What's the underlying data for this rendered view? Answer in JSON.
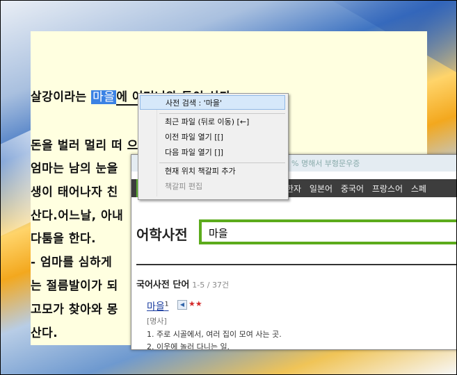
{
  "reader": {
    "lines": [
      {
        "pre": "살강이라는 ",
        "hl": "마을",
        "post": "에 어머니와 둘이 산다."
      },
      {
        "text": "돈을 벌러 멀리 떠                                  으며 엄마랑 둘이산다."
      },
      {
        "text": "엄마는 남의 눈을 "
      },
      {
        "text": "생이 태어나자 친"
      },
      {
        "text": "산다.어느날, 아내"
      },
      {
        "text": "다툼을 한다."
      },
      {
        "text": "- 엄마를 심하게 "
      },
      {
        "text": "는 절름발이가 되"
      },
      {
        "text": "고모가 찾아와 몽"
      },
      {
        "text": "산다."
      }
    ]
  },
  "context_menu": {
    "items": [
      {
        "label": "사전 검색 : '마을'",
        "state": "selected"
      },
      {
        "label": "최근 파일 (뒤로 이동) [←]",
        "state": "normal"
      },
      {
        "label": "이전 파일 열기 [[]",
        "state": "normal"
      },
      {
        "label": "다음 파일 열기 []]",
        "state": "normal"
      },
      {
        "label": "현재 위치 책갈피 추가",
        "state": "normal"
      },
      {
        "label": "책갈피 편집",
        "state": "disabled"
      }
    ]
  },
  "dictionary": {
    "top_blur": "% 명해서 부형문우증",
    "nav": [
      "한자",
      "일본어",
      "중국어",
      "프랑스어",
      "스페"
    ],
    "title": "어학사전",
    "search_value": "마을",
    "section_title": "국어사전 단어",
    "section_count": "1-5 / 37건",
    "entry": {
      "word": "마을",
      "sup": "1",
      "speaker": "speaker-icon",
      "stars": "★★",
      "pos": "[명사]",
      "def1": "1. 주로 시골에서, 여러 집이 모여 사는 곳.",
      "def2": "2. 이웃에 놀러 다니는 일."
    }
  },
  "colors": {
    "highlight": "#3b82e4",
    "reader_bg": "#ffffe0",
    "search_border": "#5cab1c",
    "nav_bg": "#3d3d3d"
  }
}
